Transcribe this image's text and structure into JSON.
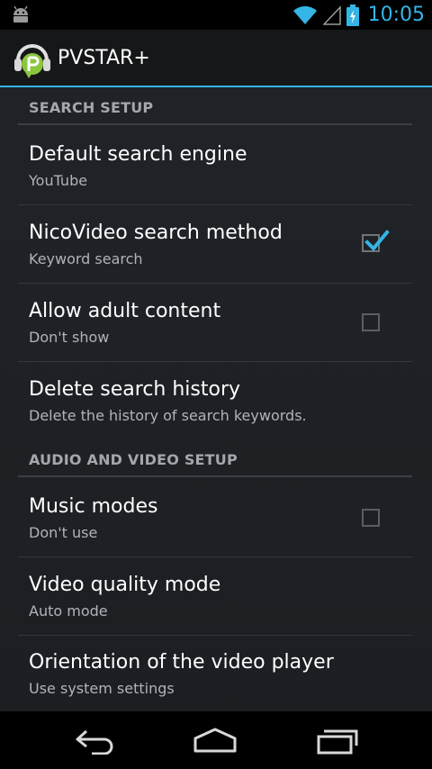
{
  "status_bar": {
    "time": "10:05",
    "icons": [
      "android-icon",
      "wifi-icon",
      "signal-icon",
      "battery-charging-icon"
    ],
    "accent_color": "#33b5e5"
  },
  "action_bar": {
    "app_title": "PVSTAR+",
    "logo_icon": "pvstar-logo-icon"
  },
  "settings": {
    "search_setup": {
      "header": "SEARCH SETUP",
      "items": [
        {
          "title": "Default search engine",
          "summary": "YouTube"
        },
        {
          "title": "NicoVideo search method",
          "summary": "Keyword search",
          "checked": true
        },
        {
          "title": "Allow adult content",
          "summary": "Don't show",
          "checked": false
        },
        {
          "title": "Delete search history",
          "summary": "Delete the history of search keywords."
        }
      ]
    },
    "audio_video_setup": {
      "header": "AUDIO AND VIDEO SETUP",
      "items": [
        {
          "title": "Music modes",
          "summary": "Don't use",
          "checked": false
        },
        {
          "title": "Video quality mode",
          "summary": "Auto mode"
        },
        {
          "title": "Orientation of the video player",
          "summary": "Use system settings"
        }
      ]
    }
  },
  "nav_bar": {
    "icons": [
      "back-icon",
      "home-icon",
      "recent-apps-icon"
    ]
  }
}
